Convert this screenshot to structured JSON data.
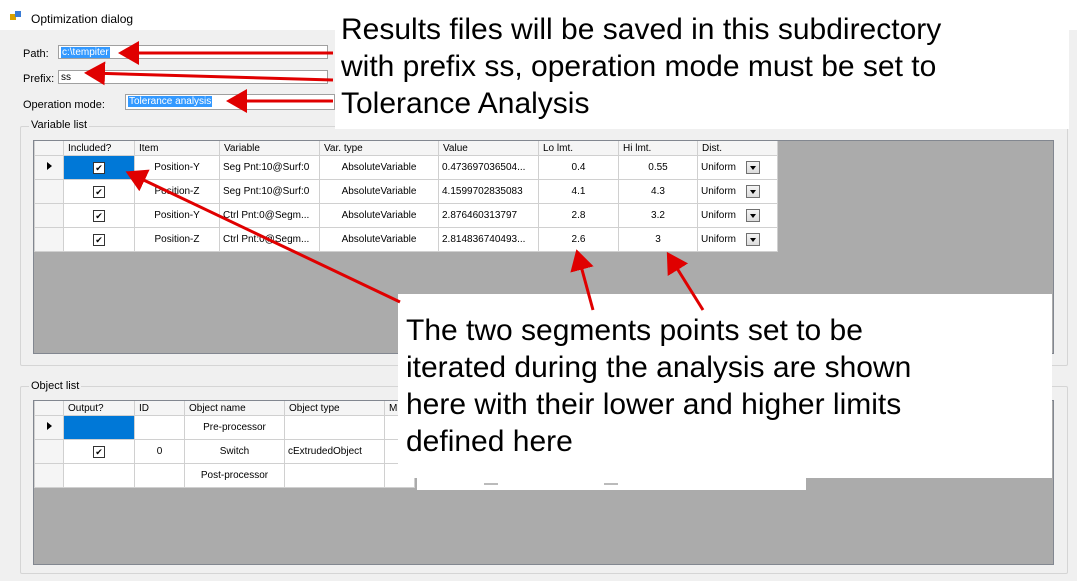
{
  "window": {
    "title": "Optimization dialog"
  },
  "form": {
    "path_label": "Path:",
    "path_value": "c:\\tempiter",
    "prefix_label": "Prefix:",
    "prefix_value": "ss",
    "mode_label": "Operation mode:",
    "mode_value": "Tolerance analysis"
  },
  "variable_list": {
    "title": "Variable list",
    "columns": [
      "Included?",
      "Item",
      "Variable",
      "Var. type",
      "Value",
      "Lo lmt.",
      "Hi lmt.",
      "Dist."
    ],
    "rows": [
      {
        "included": true,
        "item": "Position-Y",
        "variable": "Seg Pnt:10@Surf:0",
        "var_type": "AbsoluteVariable",
        "value": "0.473697036504...",
        "lo": "0.4",
        "hi": "0.55",
        "dist": "Uniform"
      },
      {
        "included": true,
        "item": "Position-Z",
        "variable": "Seg Pnt:10@Surf:0",
        "var_type": "AbsoluteVariable",
        "value": "4.1599702835083",
        "lo": "4.1",
        "hi": "4.3",
        "dist": "Uniform"
      },
      {
        "included": true,
        "item": "Position-Y",
        "variable": "Ctrl Pnt:0@Segm...",
        "var_type": "AbsoluteVariable",
        "value": "2.876460313797",
        "lo": "2.8",
        "hi": "3.2",
        "dist": "Uniform"
      },
      {
        "included": true,
        "item": "Position-Z",
        "variable": "Ctrl Pnt:0@Segm...",
        "var_type": "AbsoluteVariable",
        "value": "2.814836740493...",
        "lo": "2.6",
        "hi": "3",
        "dist": "Uniform"
      }
    ]
  },
  "object_list": {
    "title": "Object list",
    "columns": [
      "Output?",
      "ID",
      "Object name",
      "Object type",
      "M"
    ],
    "rows": [
      {
        "output": null,
        "id": "",
        "name": "Pre-processor",
        "type": ""
      },
      {
        "output": true,
        "id": "0",
        "name": "Switch",
        "type": "cExtrudedObject"
      },
      {
        "output": null,
        "id": "",
        "name": "Post-processor",
        "type": ""
      }
    ]
  },
  "annotations": {
    "top": [
      "Results files will be saved in this subdirectory",
      "with prefix ss, operation mode must be set to",
      "Tolerance Analysis"
    ],
    "middle": [
      "The two segments points set to be",
      "iterated during the analysis are shown",
      "here with their lower and higher limits",
      "defined here"
    ]
  },
  "colors": {
    "selection": "#0078d7",
    "grid_bg": "#ababab",
    "arrow": "#e00000"
  }
}
